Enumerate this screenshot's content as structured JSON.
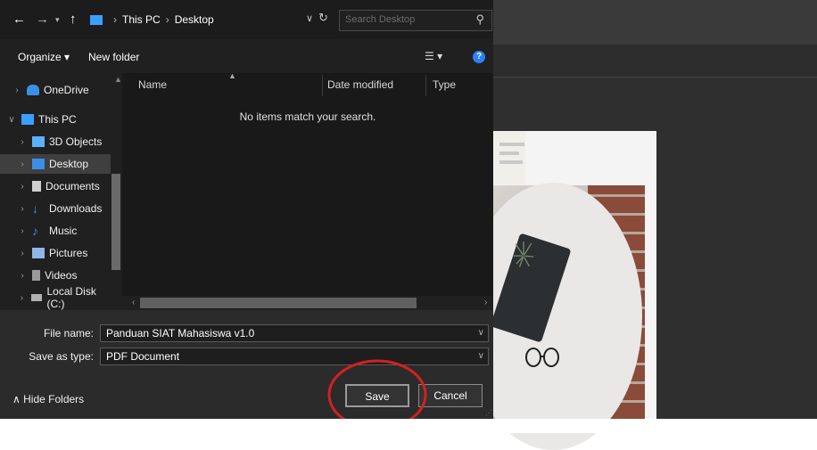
{
  "address": {
    "root": "This PC",
    "current": "Desktop"
  },
  "search": {
    "placeholder": "Search Desktop"
  },
  "toolbar": {
    "organize": "Organize ▾",
    "new_folder": "New folder",
    "help": "?"
  },
  "sidebar": {
    "items": [
      {
        "label": "OneDrive",
        "icon": "cloud-icon",
        "color": "#3a8fe8"
      },
      {
        "label": "This PC",
        "icon": "computer-icon",
        "color": "#3aa0ff"
      },
      {
        "label": "3D Objects",
        "icon": "cube-icon",
        "color": "#5ab2ff"
      },
      {
        "label": "Desktop",
        "icon": "desktop-icon",
        "color": "#3a8fe8",
        "selected": true
      },
      {
        "label": "Documents",
        "icon": "document-icon",
        "color": "#cfcfcf"
      },
      {
        "label": "Downloads",
        "icon": "download-icon",
        "color": "#3a8fe8"
      },
      {
        "label": "Music",
        "icon": "music-icon",
        "color": "#3a8fe8"
      },
      {
        "label": "Pictures",
        "icon": "pictures-icon",
        "color": "#8fb8e8"
      },
      {
        "label": "Videos",
        "icon": "video-icon",
        "color": "#9a9a9a"
      },
      {
        "label": "Local Disk (C:)",
        "icon": "disk-icon",
        "color": "#b0b0b0"
      }
    ]
  },
  "columns": {
    "name": "Name",
    "date_modified": "Date modified",
    "type": "Type"
  },
  "empty_message": "No items match your search.",
  "form": {
    "file_name_label": "File name:",
    "file_name_value": "Panduan SIAT Mahasiswa v1.0",
    "save_as_type_label": "Save as type:",
    "save_as_type_value": "PDF Document"
  },
  "footer": {
    "hide_folders": "Hide Folders",
    "save": "Save",
    "cancel": "Cancel"
  },
  "colors": {
    "annotation_circle": "#d42020"
  }
}
